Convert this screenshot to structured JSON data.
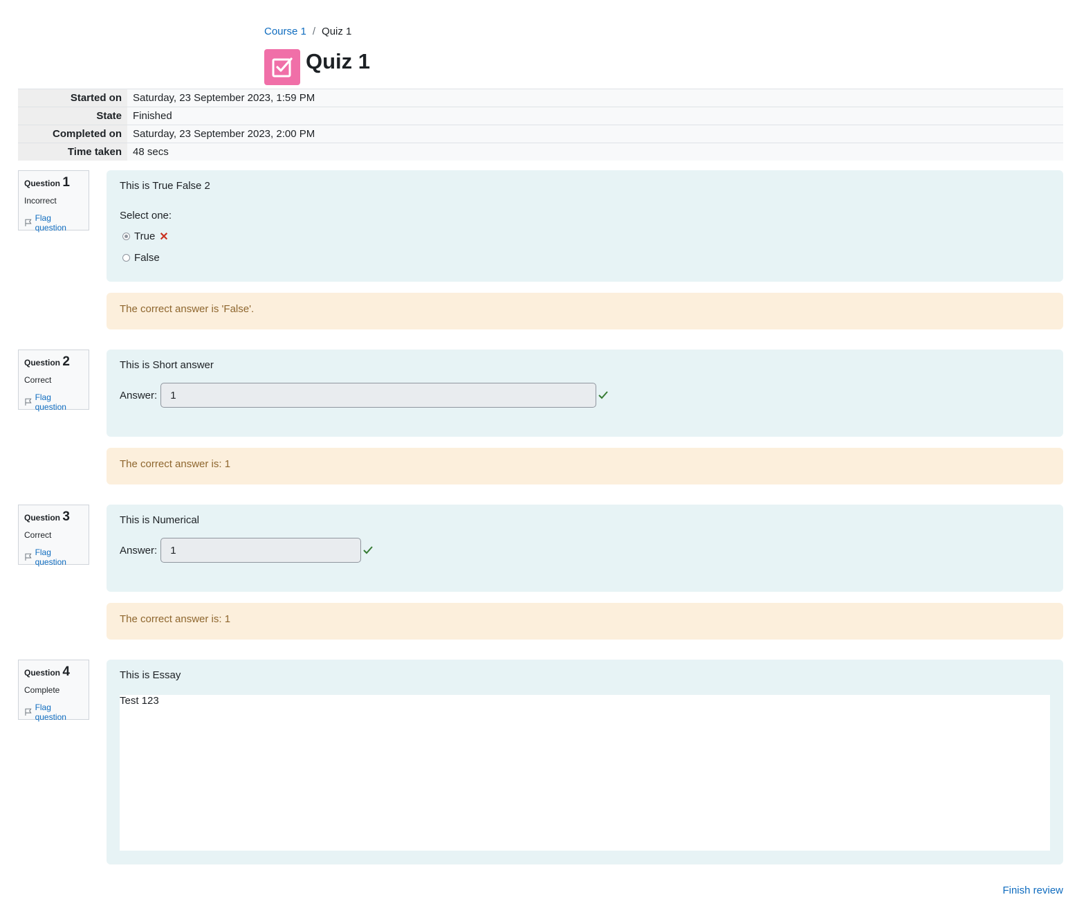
{
  "breadcrumb": {
    "course": "Course 1",
    "separator": "/",
    "current": "Quiz 1"
  },
  "page_title": "Quiz 1",
  "icon_color": "#f06fa8",
  "summary": [
    {
      "label": "Started on",
      "value": "Saturday, 23 September 2023, 1:59 PM"
    },
    {
      "label": "State",
      "value": "Finished"
    },
    {
      "label": "Completed on",
      "value": "Saturday, 23 September 2023, 2:00 PM"
    },
    {
      "label": "Time taken",
      "value": "48 secs"
    }
  ],
  "questions": [
    {
      "label": "Question",
      "number": "1",
      "state": "Incorrect",
      "flag": "Flag question",
      "text": "This is True False 2",
      "prompt": "Select one:",
      "options": [
        {
          "label": "True",
          "selected": true,
          "mark": "incorrect"
        },
        {
          "label": "False",
          "selected": false
        }
      ],
      "feedback": "The correct answer is 'False'."
    },
    {
      "label": "Question",
      "number": "2",
      "state": "Correct",
      "flag": "Flag question",
      "text": "This is Short answer",
      "answer_label": "Answer:",
      "answer": "1",
      "feedback": "The correct answer is: 1"
    },
    {
      "label": "Question",
      "number": "3",
      "state": "Correct",
      "flag": "Flag question",
      "text": "This is Numerical",
      "answer_label": "Answer:",
      "answer": "1",
      "feedback": "The correct answer is: 1"
    },
    {
      "label": "Question",
      "number": "4",
      "state": "Complete",
      "flag": "Flag question",
      "text": "This is Essay",
      "response": "Test 123"
    }
  ],
  "finish_review": "Finish review",
  "icons": {
    "quiz": "quiz-checkbox-icon",
    "flag": "flag-icon",
    "incorrect": "cross-icon",
    "correct": "check-icon"
  },
  "colors": {
    "link": "#0f6cbf",
    "question_bg": "#e7f3f5",
    "feedback_bg": "#fcefdc",
    "feedback_text": "#8e662e",
    "incorrect": "#ca3120",
    "correct": "#357a32"
  }
}
